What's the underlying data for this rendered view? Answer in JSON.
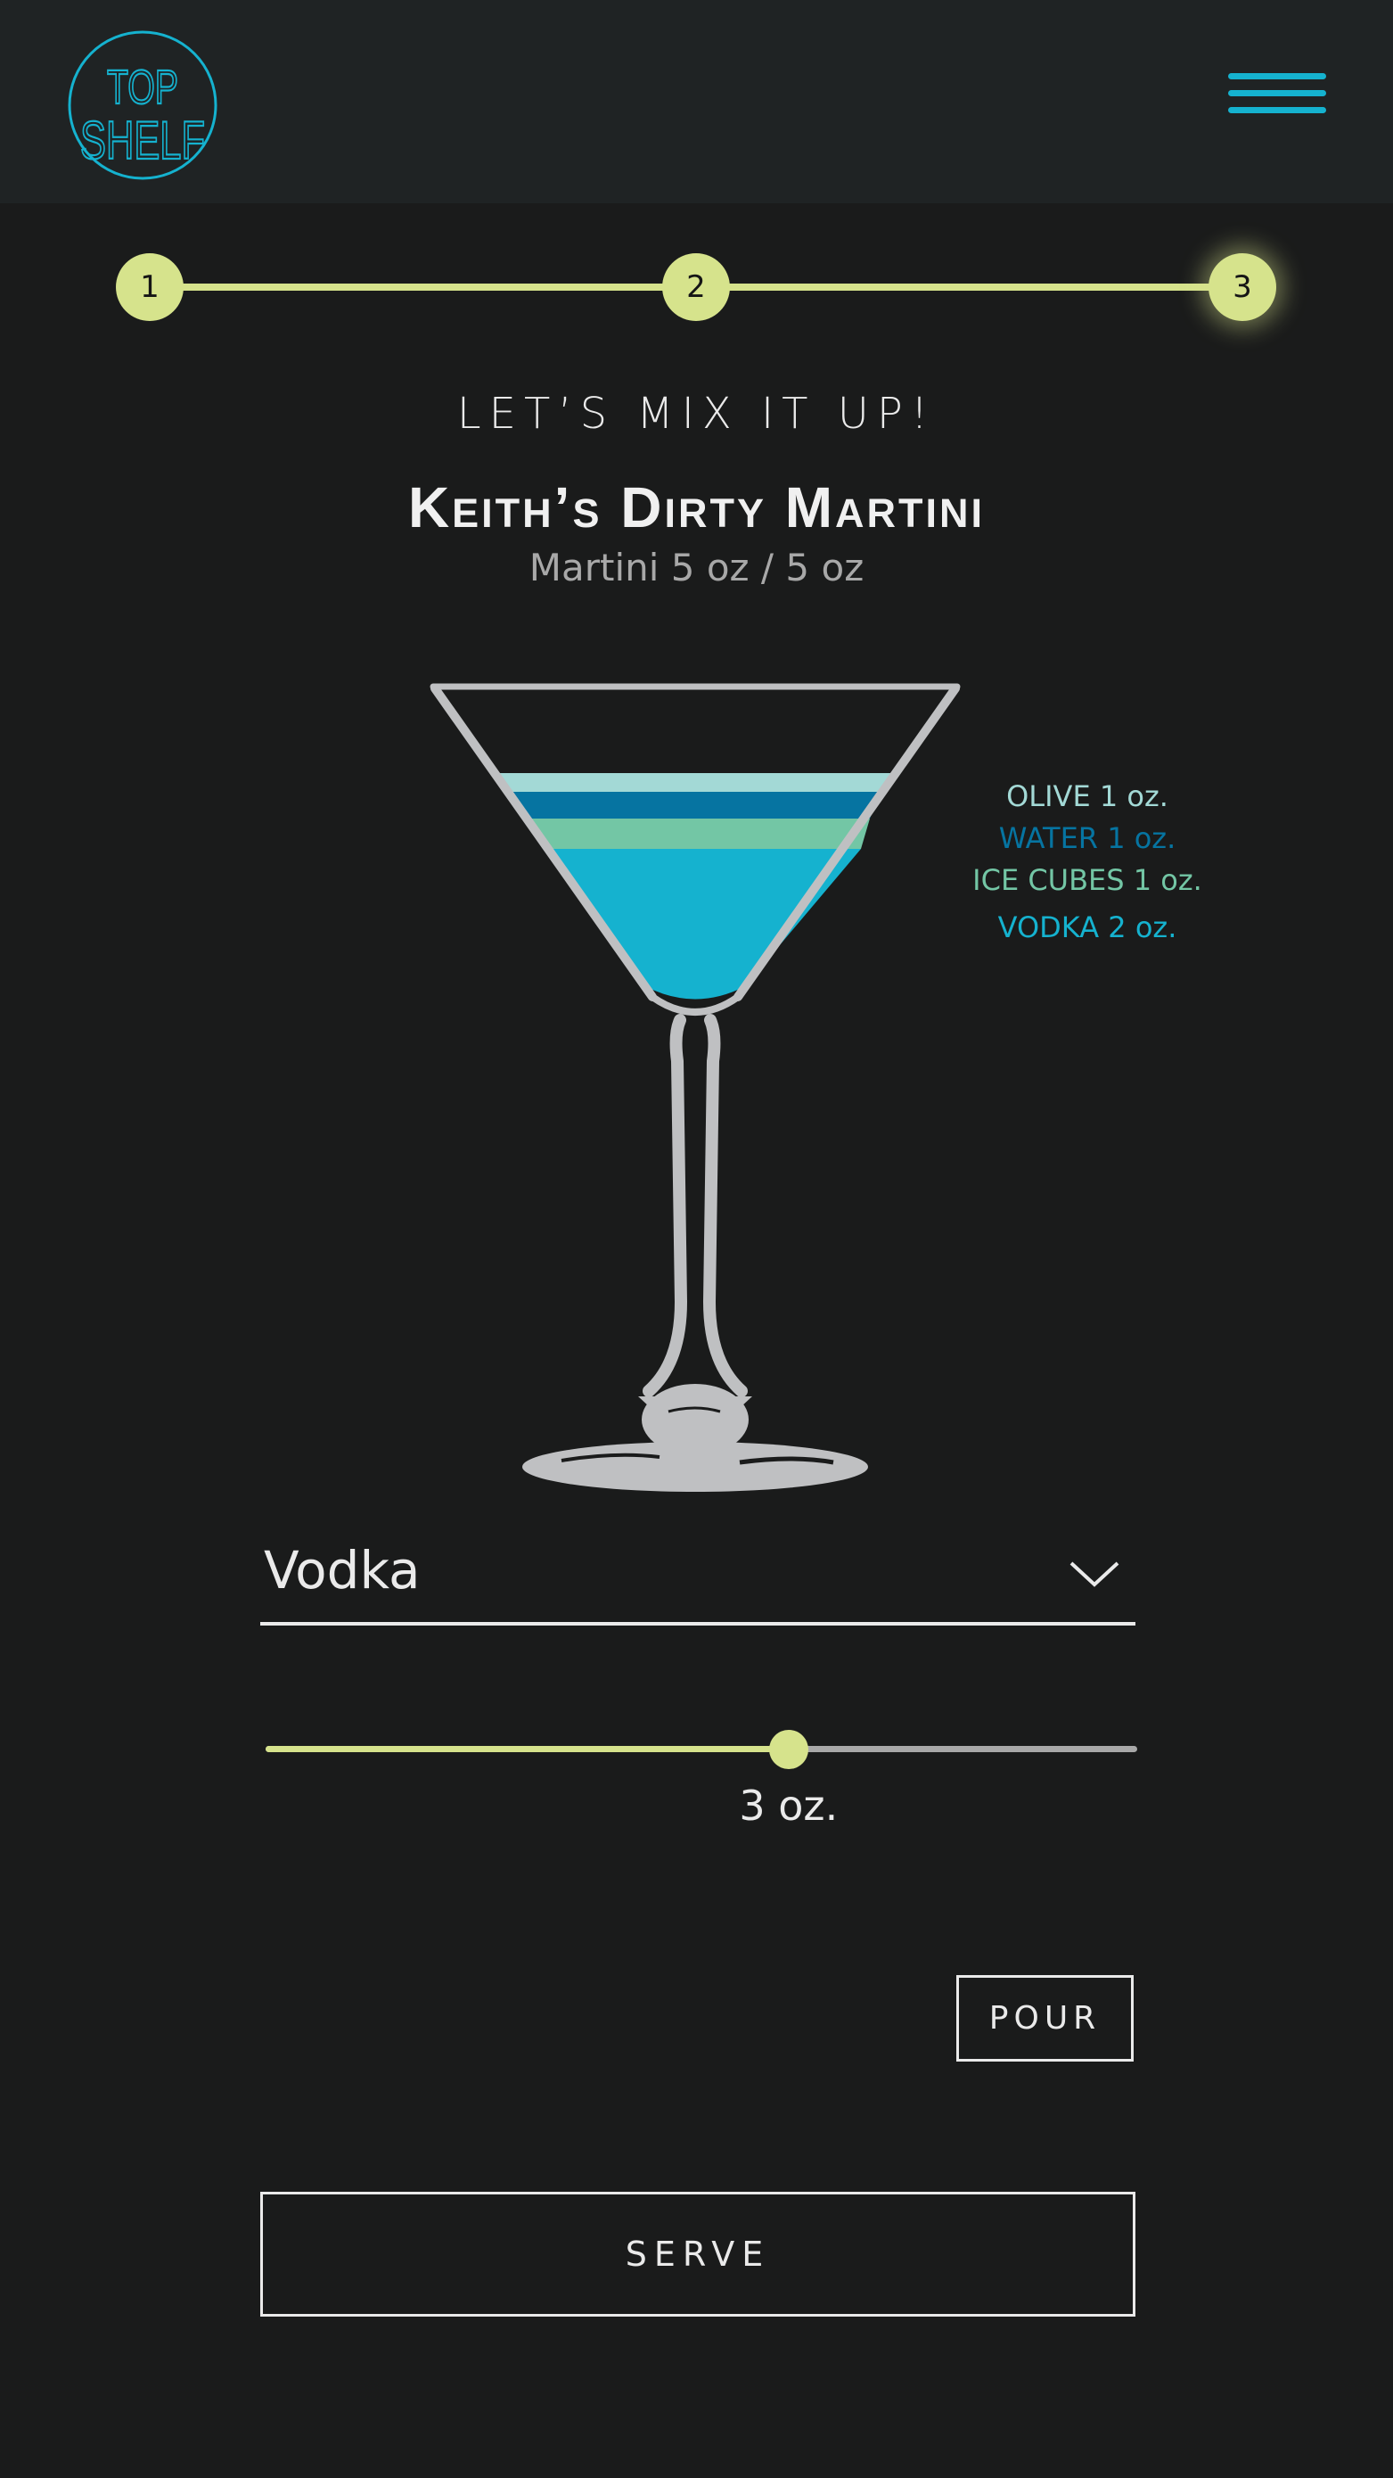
{
  "app": {
    "logo_text": [
      "TOP",
      "SHELF"
    ],
    "accent": "#15b2cf",
    "highlight": "#d6e38c"
  },
  "stepper": {
    "steps": [
      "1",
      "2",
      "3"
    ],
    "active_step": 3
  },
  "mix": {
    "heading": "LET’S MIX IT UP!",
    "drink_name": "Keith’s Dirty Martini",
    "summary": "Martini 5 oz / 5 oz"
  },
  "ingredients": [
    {
      "label": "OLIVE 1 oz.",
      "color": "#a3d9d6"
    },
    {
      "label": "WATER 1 oz.",
      "color": "#0674a1"
    },
    {
      "label": "ICE CUBES 1 oz.",
      "color": "#73c6a5"
    },
    {
      "label": "VODKA 2 oz.",
      "color": "#15b2cf"
    }
  ],
  "glass_fill": {
    "total_oz": 5,
    "layers_top_to_bottom": [
      {
        "name": "olive",
        "oz": 1,
        "color": "#a3d9d6"
      },
      {
        "name": "water",
        "oz": 1,
        "color": "#0674a1"
      },
      {
        "name": "ice-cubes",
        "oz": 1,
        "color": "#73c6a5"
      },
      {
        "name": "vodka",
        "oz": 2,
        "color": "#15b2cf"
      }
    ]
  },
  "selector": {
    "selected": "Vodka",
    "icon": "chevron-down-icon"
  },
  "amount": {
    "value_label": "3 oz.",
    "fraction": 0.6
  },
  "actions": {
    "pour_label": "POUR",
    "serve_label": "SERVE"
  }
}
